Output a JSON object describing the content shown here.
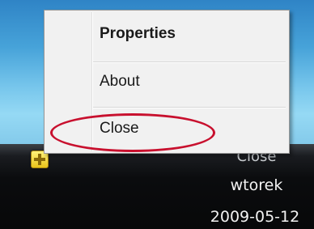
{
  "context_menu": {
    "items": [
      {
        "label": "Properties",
        "bold": true
      },
      {
        "label": "About",
        "bold": false
      },
      {
        "label": "Close",
        "bold": false
      }
    ]
  },
  "taskbar": {
    "time": "Close",
    "day": "wtorek",
    "date": "2009-05-12"
  },
  "tray_icon": {
    "icon": "plus-icon",
    "color": "#e8c21a"
  },
  "annotation": {
    "color": "#c8102e"
  }
}
